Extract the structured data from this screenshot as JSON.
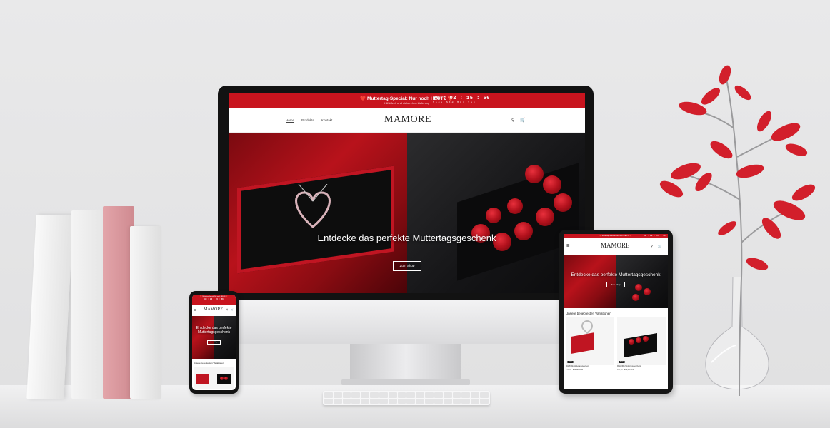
{
  "colors": {
    "brand_red": "#c8141e",
    "dark": "#121212"
  },
  "announcement": {
    "promo": "❤️ Muttertag-Special: Nur noch HEUTE ❤️",
    "promo_sub": "Hilfsbfeell und sicherehen Lieferung"
  },
  "countdown": {
    "time": "00 : 02 : 15 : 56",
    "units": "Tage Std Min Sek"
  },
  "brand": {
    "logo": "MAMORE"
  },
  "nav": [
    {
      "label": "Home"
    },
    {
      "label": "Produkte"
    },
    {
      "label": "Kontakt"
    }
  ],
  "icons": {
    "search": "search-icon",
    "cart": "cart-icon",
    "menu": "menu-icon"
  },
  "hero": {
    "title": "Entdecke das perfekte Muttertagsgeschenk",
    "cta": "Zum Shop"
  },
  "section": {
    "title": "Unsere beliebtesten Variationen"
  },
  "products": [
    {
      "title": "MAMORÉ Muttertagsgeschenk",
      "old_price": "€49,99",
      "price": "€29,99 EUR",
      "badge": "Sale"
    },
    {
      "title": "MAMORÉ Muttertagsgeschenk",
      "old_price": "€59,99",
      "price": "€39,99 EUR",
      "badge": "Sale"
    }
  ]
}
